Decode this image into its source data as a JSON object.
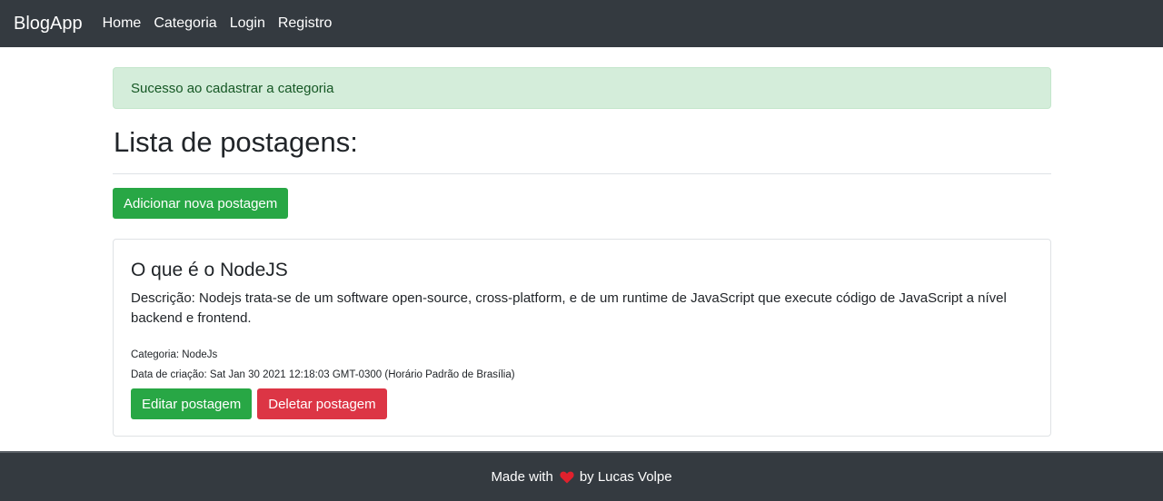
{
  "navbar": {
    "brand": "BlogApp",
    "links": [
      "Home",
      "Categoria",
      "Login",
      "Registro"
    ]
  },
  "alert": {
    "message": "Sucesso ao cadastrar a categoria"
  },
  "page": {
    "title": "Lista de postagens:",
    "add_button": "Adicionar nova postagem"
  },
  "post": {
    "title": "O que é o NodeJS",
    "description": "Descrição: Nodejs trata-se de um software open-source, cross-platform, e de um runtime de JavaScript que execute código de JavaScript a nível backend e frontend.",
    "category": "Categoria: NodeJs",
    "created": "Data de criação: Sat Jan 30 2021 12:18:03 GMT-0300 (Horário Padrão de Brasília)",
    "edit_button": "Editar postagem",
    "delete_button": "Deletar postagem"
  },
  "footer": {
    "prefix": "Made with",
    "suffix": "by Lucas Volpe",
    "icon": "heart-icon"
  },
  "colors": {
    "navbar": "#343a40",
    "success": "#28a745",
    "danger": "#dc3545",
    "alert_bg": "#d4edda",
    "heart": "#e0212d"
  }
}
